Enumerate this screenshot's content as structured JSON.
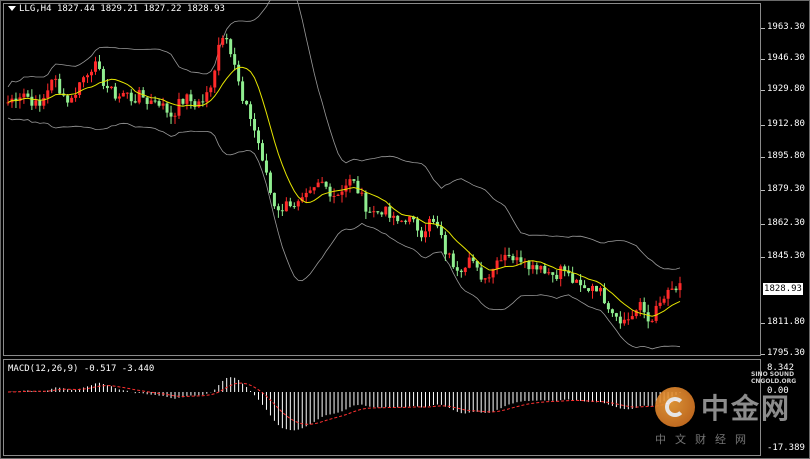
{
  "header": {
    "symbol_label": "LLG,H4",
    "ohlc": "1827.44 1829.21 1827.22 1828.93"
  },
  "macd_header": "MACD(12,26,9) -0.517 -3.440",
  "price_axis": [
    "1963.30",
    "1946.30",
    "1929.80",
    "1912.80",
    "1895.80",
    "1879.30",
    "1862.30",
    "1845.30",
    "1828.93",
    "1811.80",
    "1795.30"
  ],
  "current_price": "1828.93",
  "macd_axis": [
    "8.342",
    "0.00",
    "-17.389"
  ],
  "watermark": {
    "brand_cn": "中金网",
    "brand_sub": "中文财经网",
    "brand_en_1": "SINO SOUND",
    "brand_en_2": "CNGOLD.ORG"
  },
  "colors": {
    "up": "#ff2a2a",
    "down": "#90ee90",
    "ma": "#e6e600",
    "band": "#9a9a9a",
    "macd_hist": "#ffffff",
    "macd_signal": "#ff3030"
  },
  "chart_data": {
    "type": "candlestick",
    "ylim": [
      1795.3,
      1970
    ],
    "price_path": [
      1925,
      1928,
      1930,
      1926,
      1922,
      1932,
      1937,
      1929,
      1925,
      1934,
      1940,
      1945,
      1937,
      1931,
      1928,
      1930,
      1926,
      1929,
      1925,
      1927,
      1922,
      1918,
      1925,
      1927,
      1924,
      1926,
      1932,
      1957,
      1960,
      1945,
      1925,
      1918,
      1905,
      1888,
      1872,
      1870,
      1874,
      1872,
      1875,
      1878,
      1884,
      1880,
      1877,
      1882,
      1885,
      1878,
      1870,
      1868,
      1870,
      1865,
      1863,
      1866,
      1862,
      1858,
      1864,
      1860,
      1848,
      1842,
      1840,
      1845,
      1838,
      1834,
      1840,
      1846,
      1848,
      1843,
      1846,
      1840,
      1842,
      1838,
      1836,
      1840,
      1834,
      1830,
      1828,
      1832,
      1826,
      1820,
      1815,
      1812,
      1816,
      1820,
      1812,
      1818,
      1824,
      1828,
      1829
    ],
    "macd_ylim": [
      -17.389,
      8.342
    ]
  }
}
